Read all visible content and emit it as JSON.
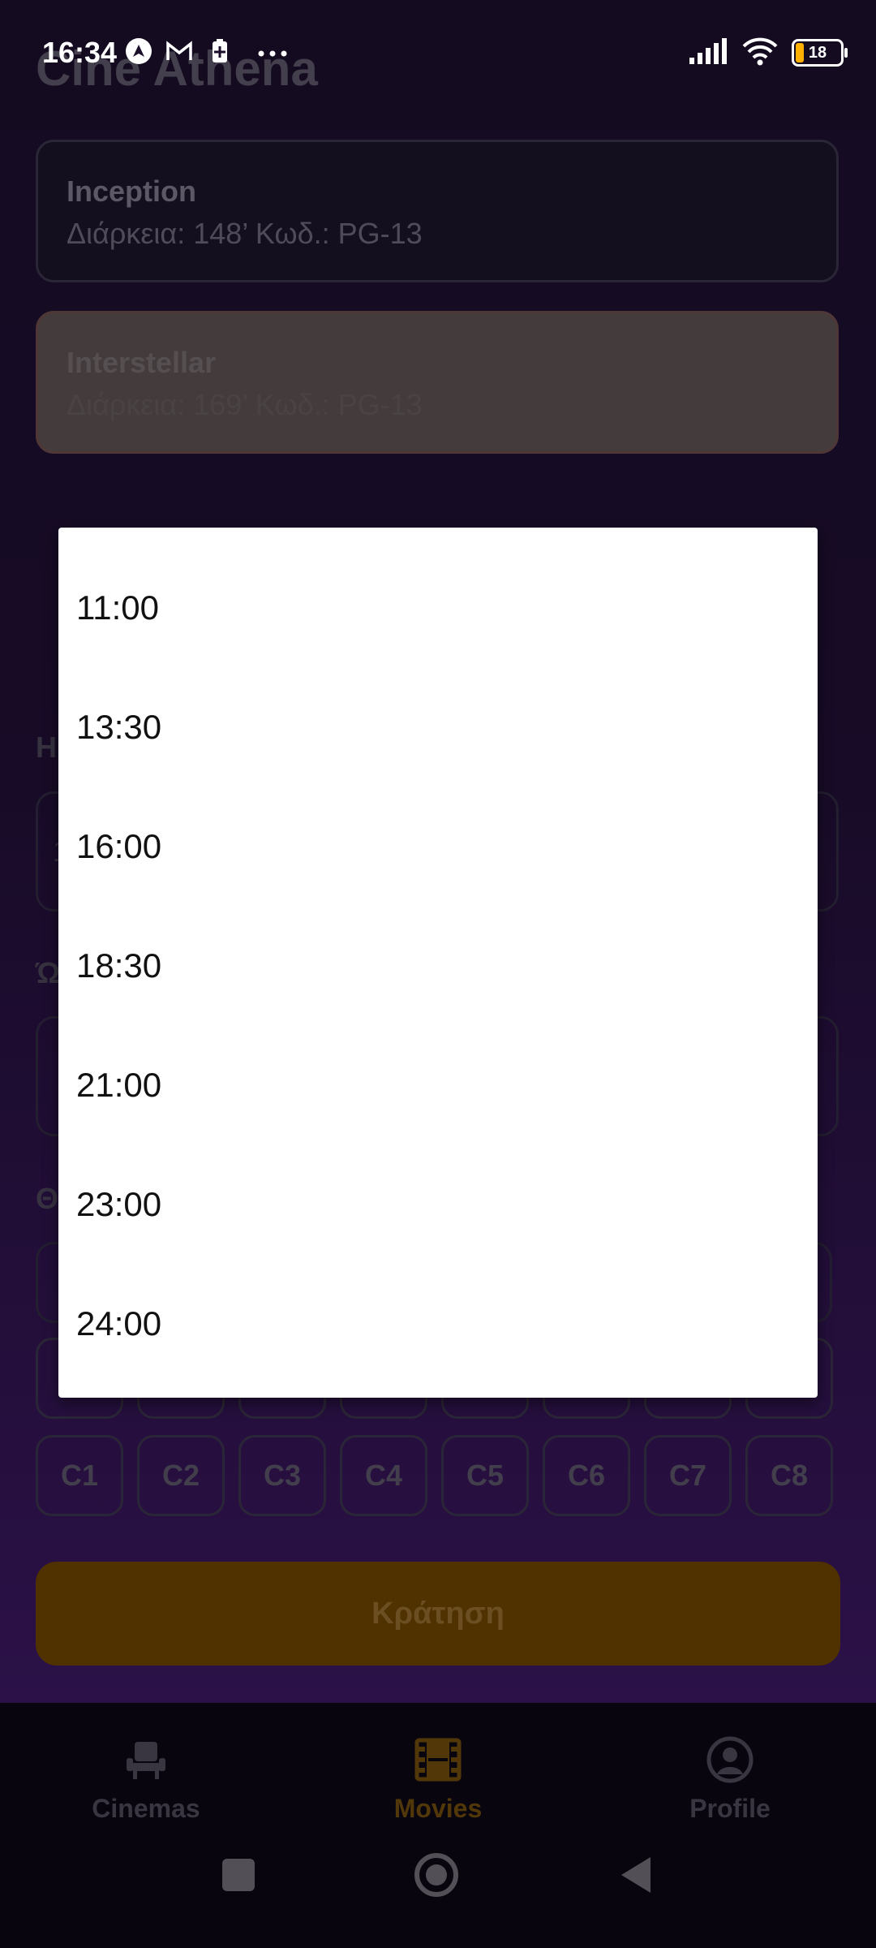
{
  "status_bar": {
    "time": "16:34",
    "battery": "18"
  },
  "header": {
    "title": "Cine Athena"
  },
  "movies": [
    {
      "title": "Inception",
      "meta": "Διάρκεια: 148’  Κωδ.: PG-13"
    },
    {
      "title": "Interstellar",
      "meta": "Διάρκεια: 169’  Κωδ.: PG-13"
    }
  ],
  "form": {
    "date_label": "Η",
    "date_value": "1",
    "time_label": "Ώ",
    "seats_label": "Θ"
  },
  "seats": {
    "row_c": [
      "C1",
      "C2",
      "C3",
      "C4",
      "C5",
      "C6",
      "C7",
      "C8"
    ]
  },
  "book_button": "Κράτηση",
  "bottom_nav": {
    "cinemas": "Cinemas",
    "movies": "Movies",
    "profile": "Profile",
    "active": "Movies"
  },
  "time_dialog": {
    "options": [
      "11:00",
      "13:30",
      "16:00",
      "18:30",
      "21:00",
      "23:00",
      "24:00"
    ]
  },
  "colors": {
    "accent": "#f2a20a",
    "background": "#1b0f2c",
    "dialog": "#ffffff"
  }
}
